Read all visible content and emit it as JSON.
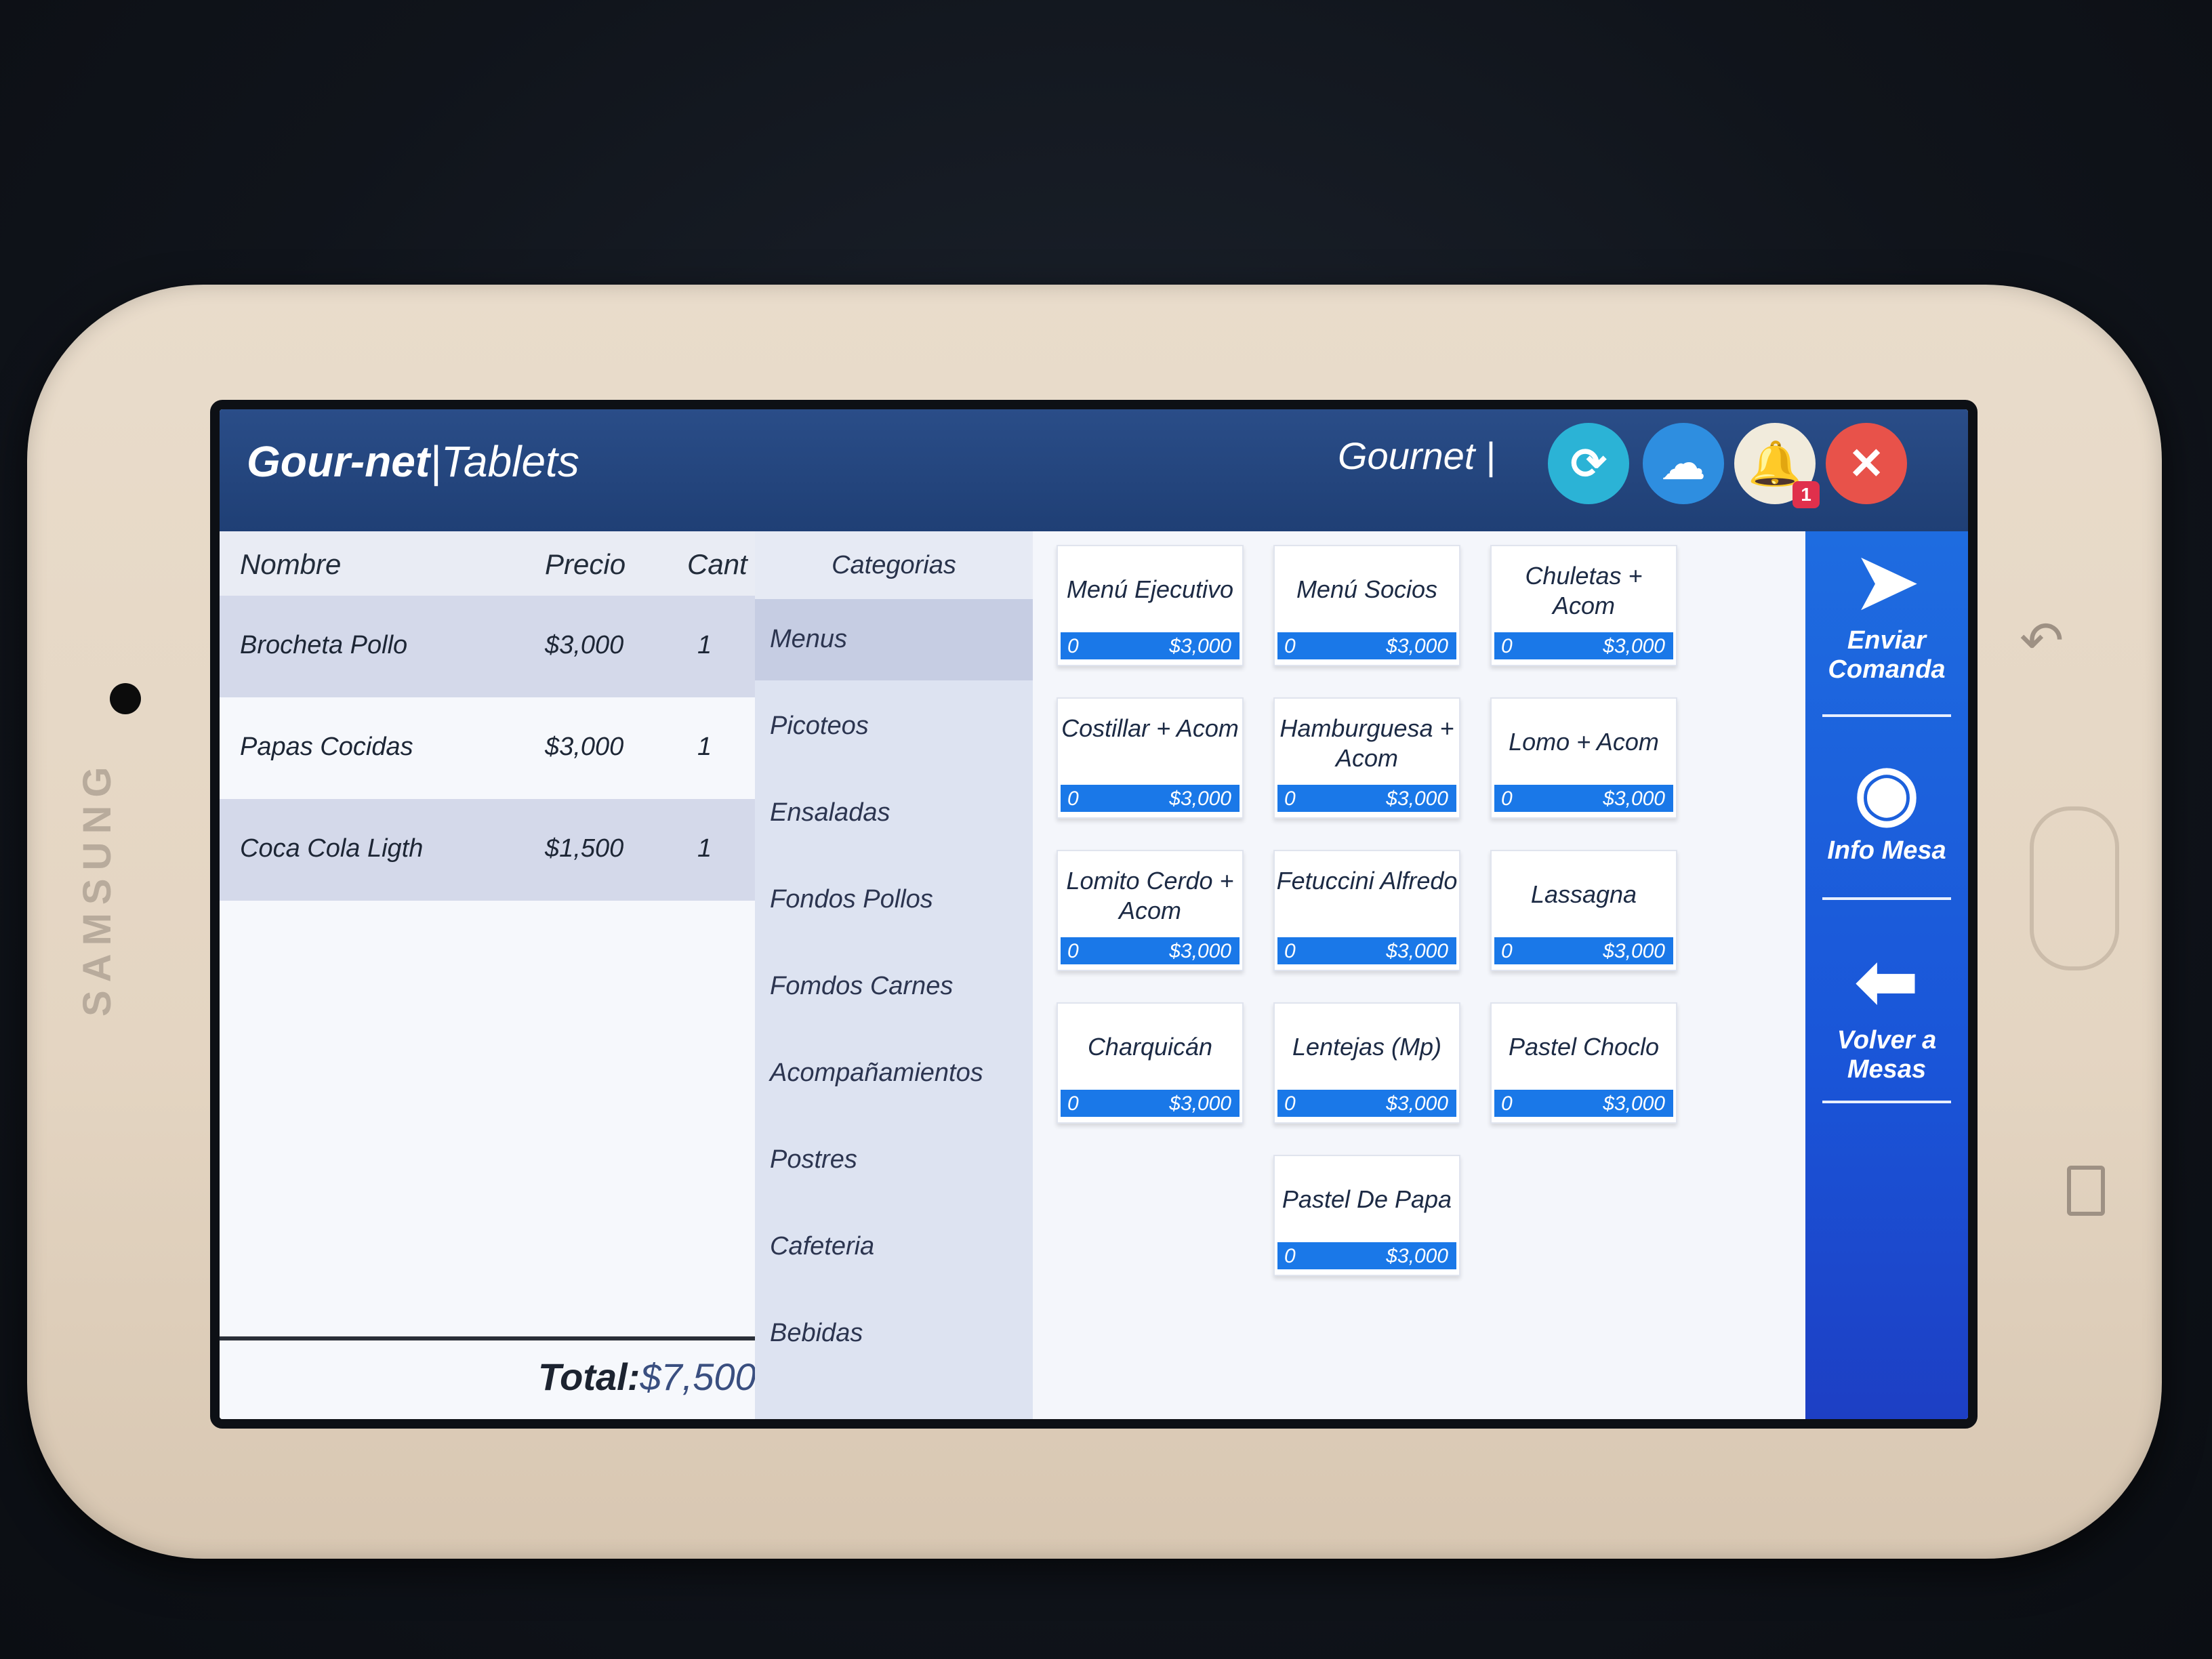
{
  "app": {
    "title_bold": "Gour-net",
    "title_sep": "|",
    "title_rest": "Tablets",
    "user": "Gournet |"
  },
  "device": {
    "brand": "SAMSUNG"
  },
  "topbar": {
    "sync_icon": "sync-icon",
    "cloud_icon": "cloud-icon",
    "bell_icon": "bell-icon",
    "notification_count": "1",
    "close_icon": "close-icon"
  },
  "order": {
    "headers": {
      "name": "Nombre",
      "price": "Precio",
      "qty": "Cant"
    },
    "rows": [
      {
        "name": "Brocheta Pollo",
        "price": "$3,000",
        "qty": "1"
      },
      {
        "name": "Papas Cocidas",
        "price": "$3,000",
        "qty": "1"
      },
      {
        "name": "Coca Cola Ligth",
        "price": "$1,500",
        "qty": "1"
      }
    ],
    "total_label": "Total:",
    "total_value": "$7,500"
  },
  "categories": {
    "header": "Categorias",
    "items": [
      "Menus",
      "Picoteos",
      "Ensaladas",
      "Fondos Pollos",
      "Fomdos Carnes",
      "Acompañamientos",
      "Postres",
      "Cafeteria",
      "Bebidas"
    ],
    "active": "Menus"
  },
  "products": [
    {
      "name": "Menú Ejecutivo",
      "qty": "0",
      "price": "$3,000"
    },
    {
      "name": "Menú Socios",
      "qty": "0",
      "price": "$3,000"
    },
    {
      "name": "Chuletas + Acom",
      "qty": "0",
      "price": "$3,000"
    },
    {
      "name": "Costillar + Acom",
      "qty": "0",
      "price": "$3,000"
    },
    {
      "name": "Hamburguesa + Acom",
      "qty": "0",
      "price": "$3,000"
    },
    {
      "name": "Lomo + Acom",
      "qty": "0",
      "price": "$3,000"
    },
    {
      "name": "Lomito Cerdo + Acom",
      "qty": "0",
      "price": "$3,000"
    },
    {
      "name": "Fetuccini Alfredo",
      "qty": "0",
      "price": "$3,000"
    },
    {
      "name": "Lassagna",
      "qty": "0",
      "price": "$3,000"
    },
    {
      "name": "Charquicán",
      "qty": "0",
      "price": "$3,000"
    },
    {
      "name": "Lentejas (Mp)",
      "qty": "0",
      "price": "$3,000"
    },
    {
      "name": "Pastel Choclo",
      "qty": "0",
      "price": "$3,000"
    },
    {
      "name": "Pastel De Papa",
      "qty": "0",
      "price": "$3,000"
    }
  ],
  "actions": [
    {
      "label": "Enviar Comanda",
      "icon": "paper-plane-icon"
    },
    {
      "label": "Info Mesa",
      "icon": "eye-icon"
    },
    {
      "label": "Volver a Mesas",
      "icon": "arrow-left-icon"
    }
  ],
  "colors": {
    "topbar": "#1f3f75",
    "accent_blue": "#1a78e8",
    "side_panel": "#1a55d8",
    "close": "#e8524a",
    "sync": "#2bb3d6"
  }
}
